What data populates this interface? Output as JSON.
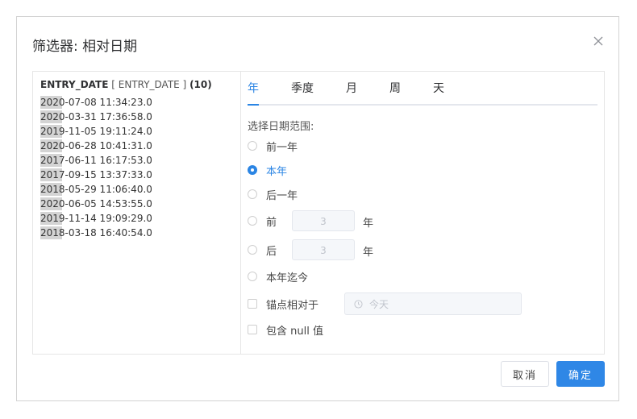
{
  "dialog": {
    "title": "筛选器: 相对日期",
    "close_label": "×"
  },
  "field": {
    "name": "ENTRY_DATE",
    "alias": "[ ENTRY_DATE ]",
    "count": "(10)",
    "values": [
      "2020-07-08 11:34:23.0",
      "2020-03-31 17:36:58.0",
      "2019-11-05 19:11:24.0",
      "2020-06-28 10:41:31.0",
      "2017-06-11 16:17:53.0",
      "2017-09-15 13:37:33.0",
      "2018-05-29 11:06:40.0",
      "2020-06-05 14:53:55.0",
      "2019-11-14 19:09:29.0",
      "2018-03-18 16:40:54.0"
    ]
  },
  "tabs": [
    {
      "label": "年",
      "active": true
    },
    {
      "label": "季度",
      "active": false
    },
    {
      "label": "月",
      "active": false
    },
    {
      "label": "周",
      "active": false
    },
    {
      "label": "天",
      "active": false
    }
  ],
  "range": {
    "label": "选择日期范围:",
    "options": {
      "previous_year": "前一年",
      "this_year": "本年",
      "next_year": "后一年",
      "previous_n_prefix": "前",
      "previous_n_value": "3",
      "previous_n_unit": "年",
      "next_n_prefix": "后",
      "next_n_value": "3",
      "next_n_unit": "年",
      "year_to_date": "本年迄今"
    },
    "selected": "this_year"
  },
  "anchor": {
    "label": "锚点相对于",
    "placeholder": "今天"
  },
  "include_null": {
    "label": "包含 null 值"
  },
  "footer": {
    "cancel_label": "取消",
    "ok_label": "确定"
  },
  "colors": {
    "accent": "#2b85e4",
    "value_highlight": "#d4d4d4"
  },
  "icons": {
    "close": "close-icon",
    "clock": "clock-icon"
  }
}
